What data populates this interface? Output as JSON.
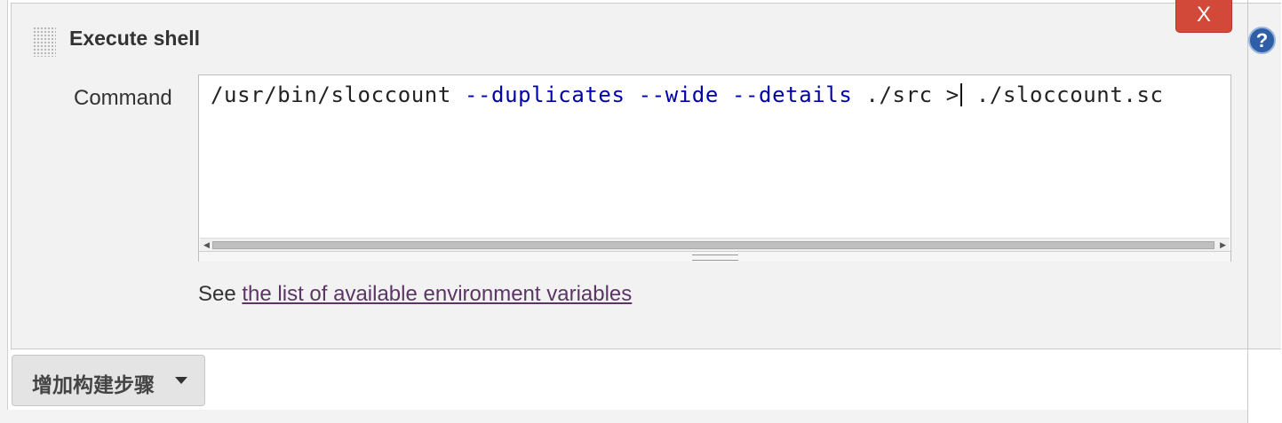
{
  "step": {
    "title": "Execute shell",
    "delete_label": "X",
    "help_label": "?"
  },
  "command": {
    "label": "Command",
    "value": "/usr/bin/sloccount --duplicates --wide --details ./src > ./sloccount.sc",
    "tokens": {
      "cmd": "/usr/bin/sloccount ",
      "opt1": "--duplicates",
      "sp1": " ",
      "opt2": "--wide",
      "sp2": " ",
      "opt3": "--details",
      "tail_before_caret": " ./src >",
      "tail_after_caret": " ./sloccount.sc"
    }
  },
  "help_text": {
    "prefix": "See ",
    "link": "the list of available environment variables"
  },
  "add_step_button": {
    "label": "增加构建步骤"
  },
  "colors": {
    "delete_button": "#d24939",
    "option_token": "#0000aa",
    "link": "#5c3566",
    "help_icon": "#2e5fa6"
  }
}
